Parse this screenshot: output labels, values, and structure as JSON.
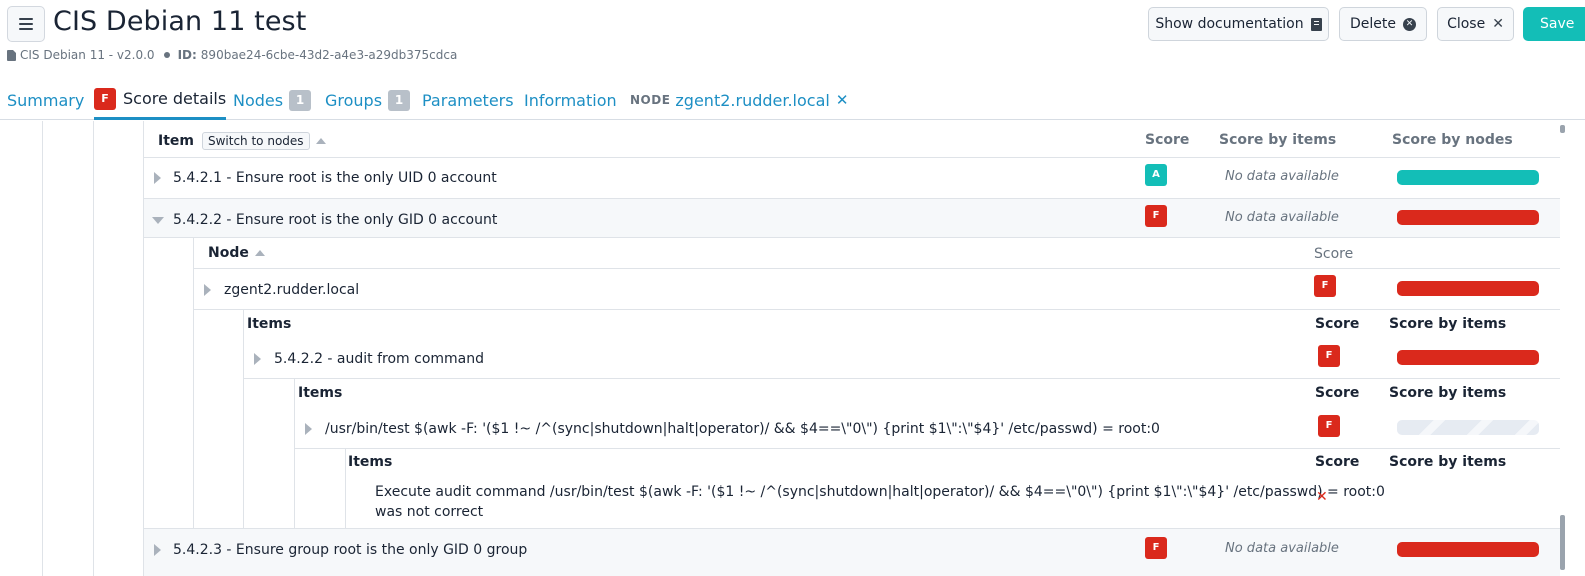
{
  "header": {
    "title": "CIS Debian 11 test",
    "technique": "CIS Debian 11 - v2.0.0",
    "id_label": "ID:",
    "id_value": "890bae24-6cbe-43d2-a4e3-a29db375cdca",
    "buttons": {
      "show_doc": "Show documentation",
      "delete": "Delete",
      "close": "Close",
      "save": "Save"
    }
  },
  "tabs": {
    "summary": "Summary",
    "score_details": "Score details",
    "score_badge": "F",
    "nodes": "Nodes",
    "nodes_count": "1",
    "groups": "Groups",
    "groups_count": "1",
    "parameters": "Parameters",
    "information": "Information",
    "node_label": "NODE",
    "node_value": "zgent2.rudder.local"
  },
  "table": {
    "col_item": "Item",
    "switch_btn": "Switch to nodes",
    "col_score": "Score",
    "col_score_items": "Score by items",
    "col_score_nodes": "Score by nodes",
    "no_data": "No data available",
    "rows": [
      {
        "label": "5.4.2.1 - Ensure root is the only UID 0 account",
        "score": "A"
      },
      {
        "label": "5.4.2.2 - Ensure root is the only GID 0 account",
        "score": "F"
      },
      {
        "label": "5.4.2.3 - Ensure group root is the only GID 0 group",
        "score": "F"
      }
    ],
    "node_sub": {
      "col_node": "Node",
      "col_score": "Score",
      "node": "zgent2.rudder.local",
      "node_score": "F"
    },
    "items1": {
      "col_items": "Items",
      "col_score": "Score",
      "col_score_items": "Score by items",
      "label": "5.4.2.2 - audit from command",
      "score": "F"
    },
    "items2": {
      "col_items": "Items",
      "col_score": "Score",
      "col_score_items": "Score by items",
      "label": "/usr/bin/test $(awk -F: '($1 !~ /^(sync|shutdown|halt|operator)/ && $4==\\\"0\\\") {print $1\\\":\\\"$4}' /etc/passwd) = root:0",
      "score": "F"
    },
    "items3": {
      "col_items": "Items",
      "col_score": "Score",
      "col_score_items": "Score by items",
      "message_line1": "Execute audit command /usr/bin/test $(awk -F: '($1 !~ /^(sync|shutdown|halt|operator)/ && $4==\\\"0\\\") {print $1\\\":\\\"$4}' /etc/passwd) = root:0",
      "message_line2": "was not correct",
      "score_icon": "close-icon"
    }
  },
  "colors": {
    "accent": "#1d8fc4",
    "teal": "#13beb7",
    "red": "#da291c",
    "muted": "#68737f"
  }
}
